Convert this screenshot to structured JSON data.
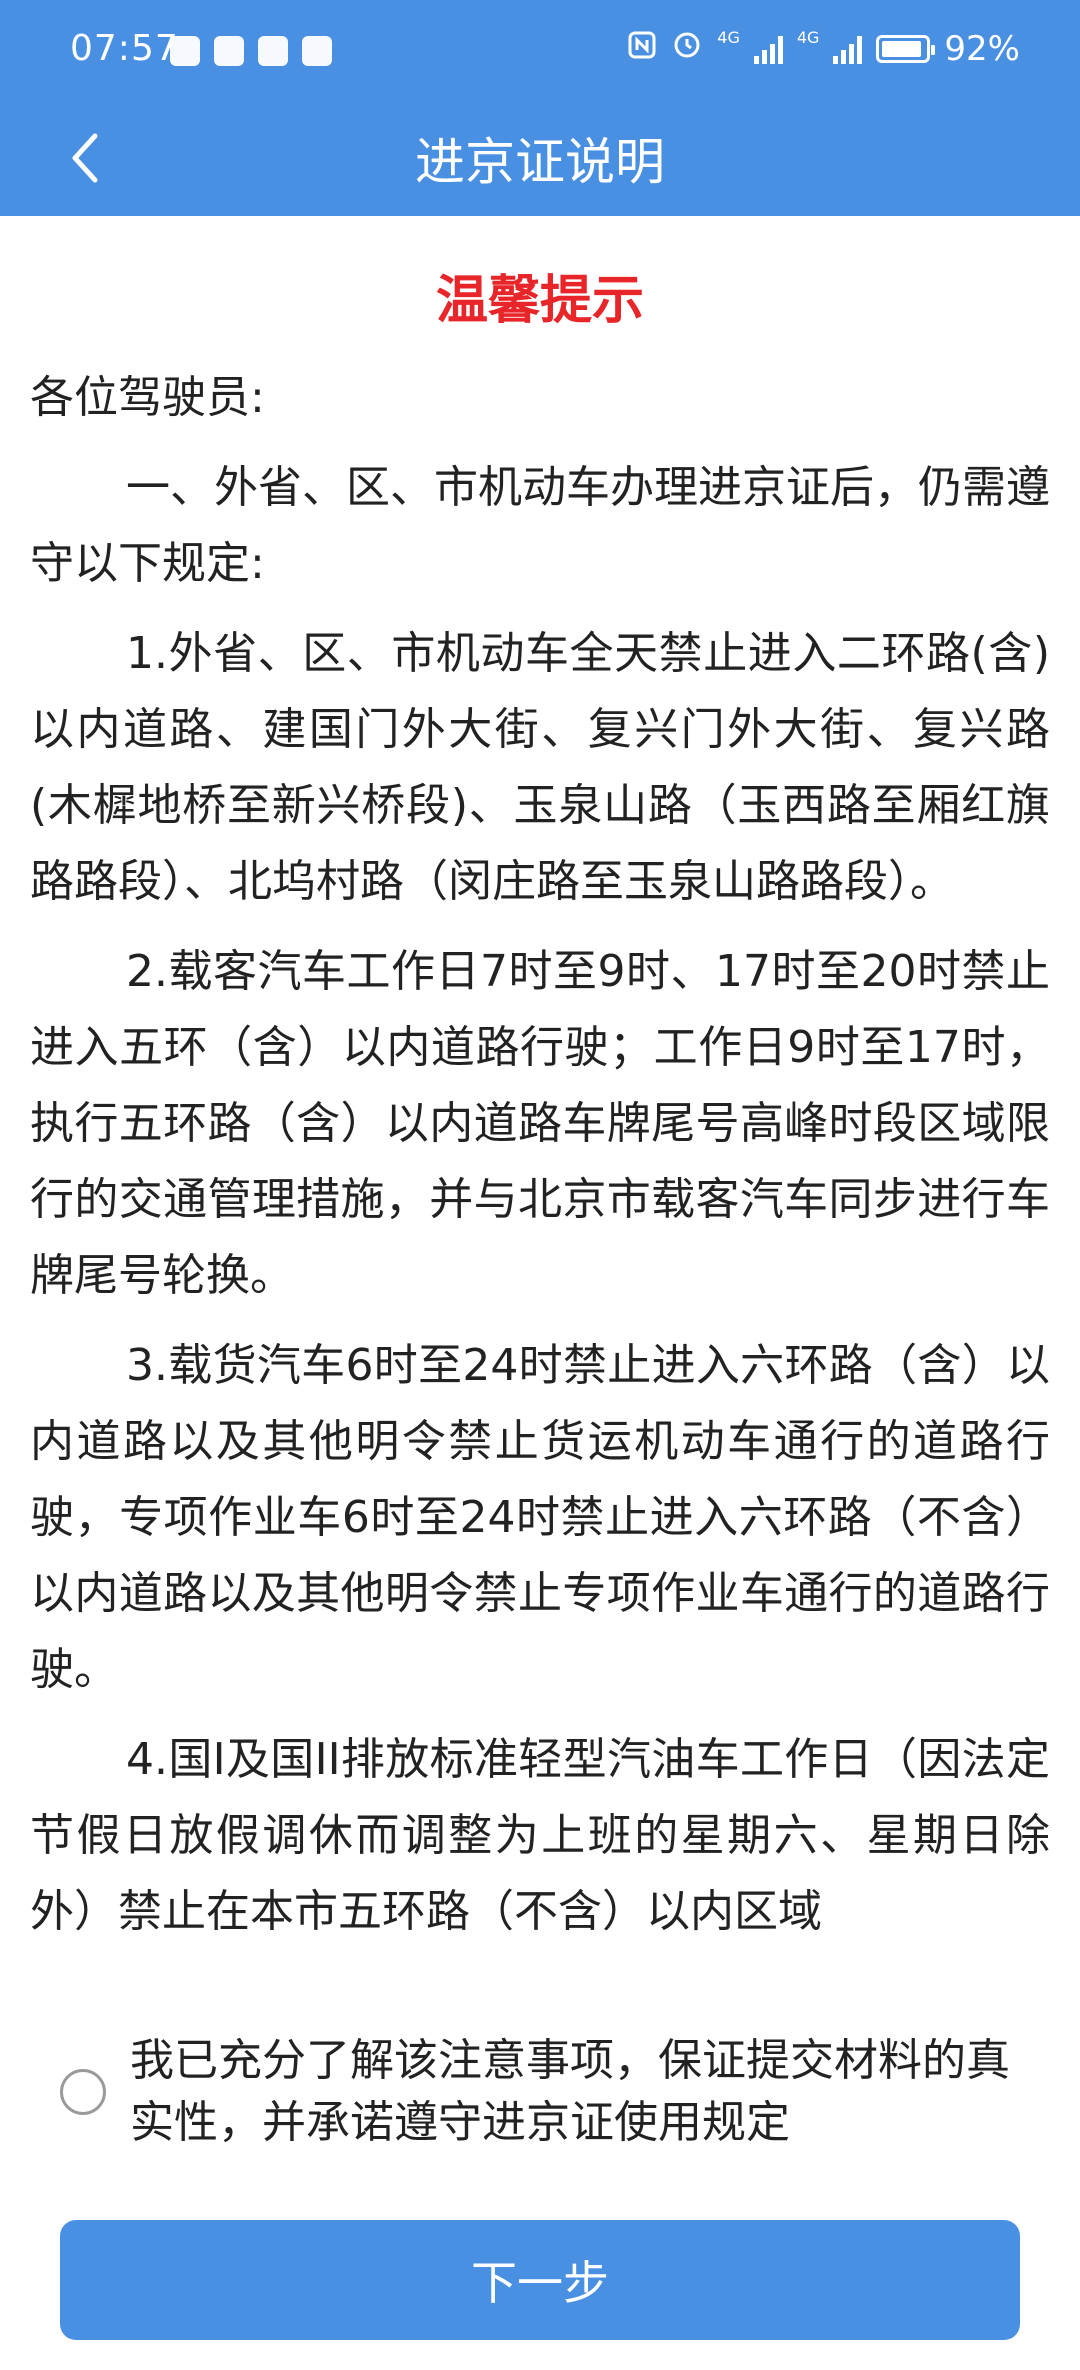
{
  "status_bar": {
    "time": "07:57",
    "battery": "92%",
    "network_1": "4G",
    "network_2": "4G",
    "battery_level": 0.92
  },
  "nav": {
    "title": "进京证说明",
    "back_icon": "chevron-left-icon"
  },
  "notice": {
    "title": "温馨提示",
    "greeting": "各位驾驶员:",
    "paragraphs": [
      "一、外省、区、市机动车办理进京证后，仍需遵守以下规定:",
      "1.外省、区、市机动车全天禁止进入二环路(含)以内道路、建国门外大街、复兴门外大街、复兴路(木樨地桥至新兴桥段)、玉泉山路（玉西路至厢红旗路路段）、北坞村路（闵庄路至玉泉山路路段）。",
      "2.载客汽车工作日7时至9时、17时至20时禁止进入五环（含）以内道路行驶；工作日9时至17时，执行五环路（含）以内道路车牌尾号高峰时段区域限行的交通管理措施，并与北京市载客汽车同步进行车牌尾号轮换。",
      "3.载货汽车6时至24时禁止进入六环路（含）以内道路以及其他明令禁止货运机动车通行的道路行驶，专项作业车6时至24时禁止进入六环路（不含）以内道路以及其他明令禁止专项作业车通行的道路行驶。",
      "4.国I及国II排放标准轻型汽油车工作日（因法定节假日放假调休而调整为上班的星期六、星期日除外）禁止在本市五环路（不含）以内区域"
    ]
  },
  "agreement": {
    "text": "我已充分了解该注意事项，保证提交材料的真实性，并承诺遵守进京证使用规定",
    "checked": false
  },
  "actions": {
    "next_label": "下一步"
  },
  "colors": {
    "primary": "#4a90e2",
    "warning_title": "#e8262a"
  }
}
